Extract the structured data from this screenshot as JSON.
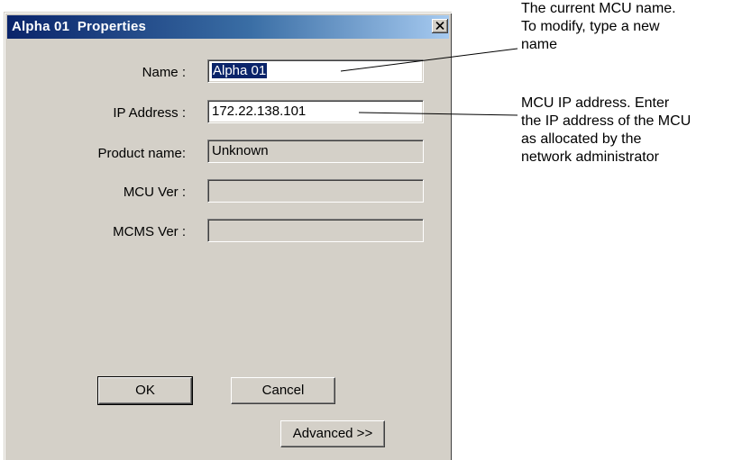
{
  "dialog": {
    "title": "Alpha 01  Properties",
    "fields": [
      {
        "label": "Name :",
        "value": "Alpha 01"
      },
      {
        "label": "IP Address :",
        "value": "172.22.138.101"
      },
      {
        "label": "Product name:",
        "value": "Unknown"
      },
      {
        "label": "MCU Ver :",
        "value": ""
      },
      {
        "label": "MCMS Ver :",
        "value": ""
      }
    ],
    "buttons": {
      "ok": "OK",
      "cancel": "Cancel",
      "advanced": "Advanced >>"
    }
  },
  "callouts": {
    "name": "The current MCU name.\nTo modify, type a new\nname",
    "ip": "MCU IP address. Enter\nthe IP address of the MCU\nas allocated by the\nnetwork administrator"
  },
  "colors": {
    "title_gradient_start": "#0a246a",
    "title_gradient_end": "#a6caf0",
    "dialog_face": "#d4d0c8",
    "selection": "#0a246a"
  },
  "icons": {
    "close": "close-icon"
  }
}
